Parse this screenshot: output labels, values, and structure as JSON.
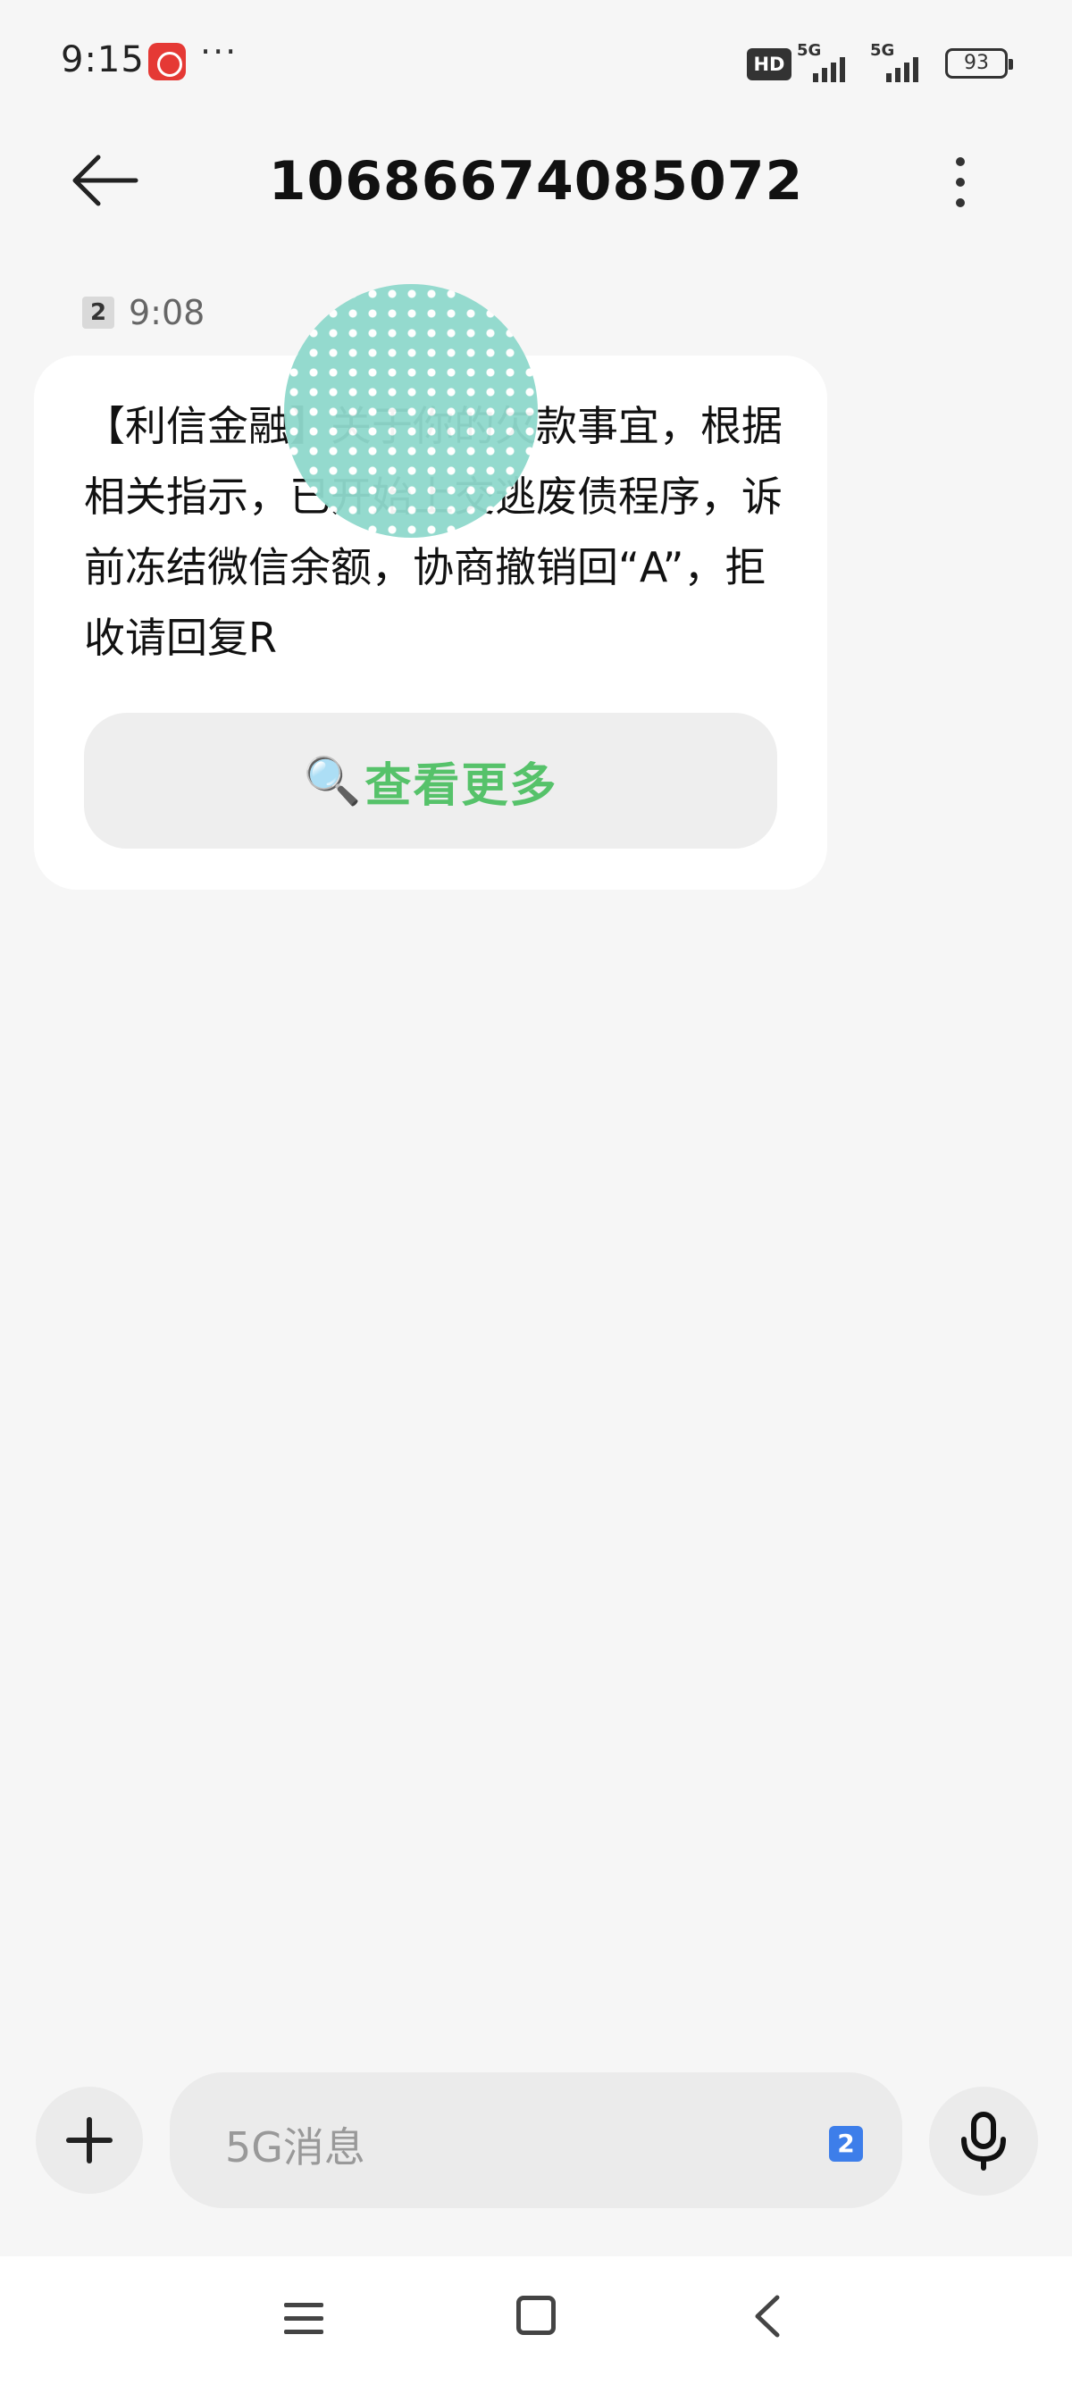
{
  "status_bar": {
    "time": "9:15",
    "more": "···",
    "hd_badge": "HD",
    "sim1_label": "5G",
    "sim2_label": "5G",
    "battery": "93",
    "notification_icon": "app-notification-icon"
  },
  "header": {
    "title": "10686674085072",
    "back_icon": "arrow-left-icon",
    "menu_icon": "more-vertical-icon"
  },
  "message": {
    "sim": "2",
    "time": "9:08",
    "text": "【利信金融】关于你的欠款事宜，根据相关指示，已开始上交逃废债程序，诉前冻结微信余额，协商撤销回“A”，拒收请回复R",
    "action": {
      "icon": "🔍",
      "label": "查看更多"
    }
  },
  "composer": {
    "placeholder": "5G消息",
    "sim": "2",
    "add_icon": "plus-icon",
    "mic_icon": "microphone-icon"
  },
  "nav": {
    "menu_icon": "menu-icon",
    "home_icon": "home-square-icon",
    "back_icon": "back-chevron-icon"
  },
  "colors": {
    "accent_green": "#56c26a",
    "sim_blue": "#3d7eea",
    "background": "#f6f6f6"
  }
}
